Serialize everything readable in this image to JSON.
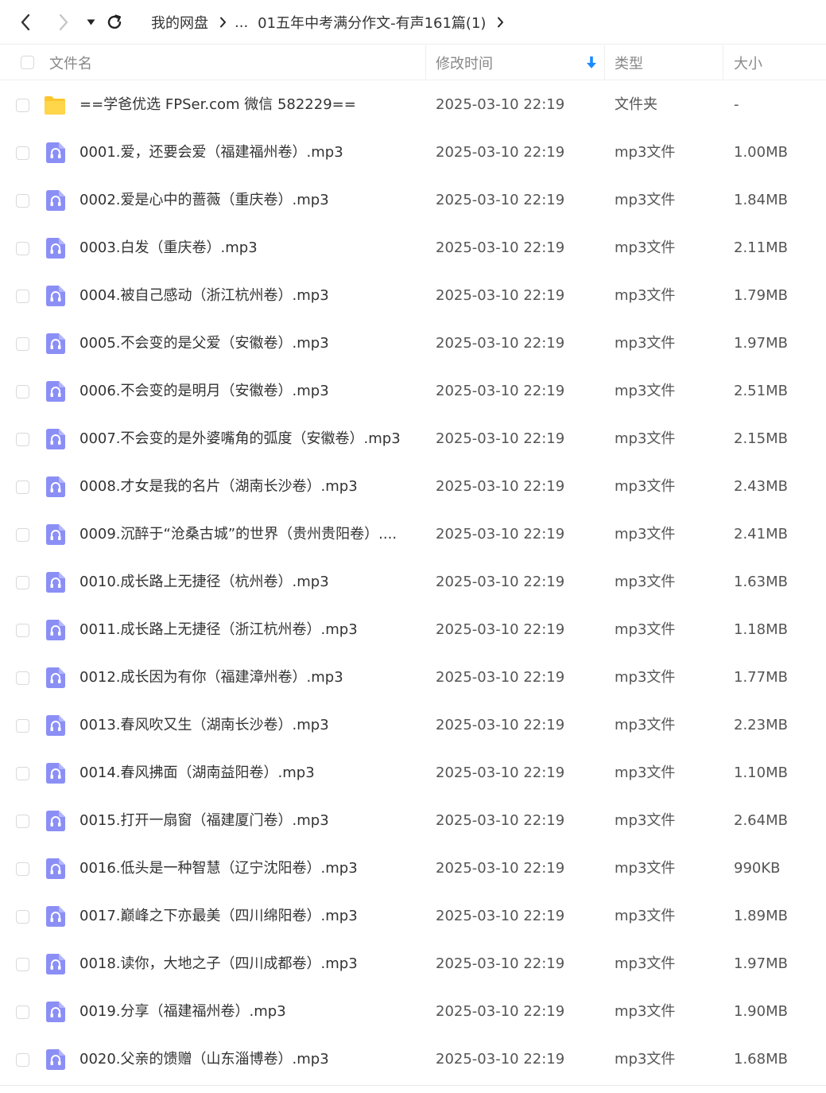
{
  "nav": {
    "back_icon": "chevron-left-icon",
    "forward_icon": "chevron-right-icon",
    "history_icon": "caret-down-icon",
    "refresh_icon": "refresh-icon",
    "breadcrumb": {
      "root": "我的网盘",
      "ellipsis": "...",
      "current": "01五年中考满分作文-有声161篇(1)"
    }
  },
  "table": {
    "headers": {
      "name": "文件名",
      "modified": "修改时间",
      "type": "类型",
      "size": "大小"
    },
    "sort": {
      "column": "modified",
      "direction": "desc",
      "icon": "arrow-down-icon",
      "color": "#1a8cff"
    },
    "rows": [
      {
        "icon": "folder-icon",
        "name": "==学爸优选 FPSer.com 微信 582229==",
        "modified": "2025-03-10 22:19",
        "type": "文件夹",
        "size": "-"
      },
      {
        "icon": "audio-file-icon",
        "name": "0001.爱，还要会爱（福建福州卷）.mp3",
        "modified": "2025-03-10 22:19",
        "type": "mp3文件",
        "size": "1.00MB"
      },
      {
        "icon": "audio-file-icon",
        "name": "0002.爱是心中的蔷薇（重庆卷）.mp3",
        "modified": "2025-03-10 22:19",
        "type": "mp3文件",
        "size": "1.84MB"
      },
      {
        "icon": "audio-file-icon",
        "name": "0003.白发（重庆卷）.mp3",
        "modified": "2025-03-10 22:19",
        "type": "mp3文件",
        "size": "2.11MB"
      },
      {
        "icon": "audio-file-icon",
        "name": "0004.被自己感动（浙江杭州卷）.mp3",
        "modified": "2025-03-10 22:19",
        "type": "mp3文件",
        "size": "1.79MB"
      },
      {
        "icon": "audio-file-icon",
        "name": "0005.不会变的是父爱（安徽卷）.mp3",
        "modified": "2025-03-10 22:19",
        "type": "mp3文件",
        "size": "1.97MB"
      },
      {
        "icon": "audio-file-icon",
        "name": "0006.不会变的是明月（安徽卷）.mp3",
        "modified": "2025-03-10 22:19",
        "type": "mp3文件",
        "size": "2.51MB"
      },
      {
        "icon": "audio-file-icon",
        "name": "0007.不会变的是外婆嘴角的弧度（安徽卷）.mp3",
        "modified": "2025-03-10 22:19",
        "type": "mp3文件",
        "size": "2.15MB"
      },
      {
        "icon": "audio-file-icon",
        "name": "0008.才女是我的名片（湖南长沙卷）.mp3",
        "modified": "2025-03-10 22:19",
        "type": "mp3文件",
        "size": "2.43MB"
      },
      {
        "icon": "audio-file-icon",
        "name": "0009.沉醉于“沧桑古城”的世界（贵州贵阳卷）....",
        "modified": "2025-03-10 22:19",
        "type": "mp3文件",
        "size": "2.41MB"
      },
      {
        "icon": "audio-file-icon",
        "name": "0010.成长路上无捷径（杭州卷）.mp3",
        "modified": "2025-03-10 22:19",
        "type": "mp3文件",
        "size": "1.63MB"
      },
      {
        "icon": "audio-file-icon",
        "name": "0011.成长路上无捷径（浙江杭州卷）.mp3",
        "modified": "2025-03-10 22:19",
        "type": "mp3文件",
        "size": "1.18MB"
      },
      {
        "icon": "audio-file-icon",
        "name": "0012.成长因为有你（福建漳州卷）.mp3",
        "modified": "2025-03-10 22:19",
        "type": "mp3文件",
        "size": "1.77MB"
      },
      {
        "icon": "audio-file-icon",
        "name": "0013.春风吹又生（湖南长沙卷）.mp3",
        "modified": "2025-03-10 22:19",
        "type": "mp3文件",
        "size": "2.23MB"
      },
      {
        "icon": "audio-file-icon",
        "name": "0014.春风拂面（湖南益阳卷）.mp3",
        "modified": "2025-03-10 22:19",
        "type": "mp3文件",
        "size": "1.10MB"
      },
      {
        "icon": "audio-file-icon",
        "name": "0015.打开一扇窗（福建厦门卷）.mp3",
        "modified": "2025-03-10 22:19",
        "type": "mp3文件",
        "size": "2.64MB"
      },
      {
        "icon": "audio-file-icon",
        "name": "0016.低头是一种智慧（辽宁沈阳卷）.mp3",
        "modified": "2025-03-10 22:19",
        "type": "mp3文件",
        "size": "990KB"
      },
      {
        "icon": "audio-file-icon",
        "name": "0017.巅峰之下亦最美（四川绵阳卷）.mp3",
        "modified": "2025-03-10 22:19",
        "type": "mp3文件",
        "size": "1.89MB"
      },
      {
        "icon": "audio-file-icon",
        "name": "0018.读你，大地之子（四川成都卷）.mp3",
        "modified": "2025-03-10 22:19",
        "type": "mp3文件",
        "size": "1.97MB"
      },
      {
        "icon": "audio-file-icon",
        "name": "0019.分享（福建福州卷）.mp3",
        "modified": "2025-03-10 22:19",
        "type": "mp3文件",
        "size": "1.90MB"
      },
      {
        "icon": "audio-file-icon",
        "name": "0020.父亲的馈赠（山东淄博卷）.mp3",
        "modified": "2025-03-10 22:19",
        "type": "mp3文件",
        "size": "1.68MB"
      }
    ]
  },
  "colors": {
    "folder": "#fcc72e",
    "audio_icon": "#8b8ff5",
    "divider": "#eeeeee"
  }
}
